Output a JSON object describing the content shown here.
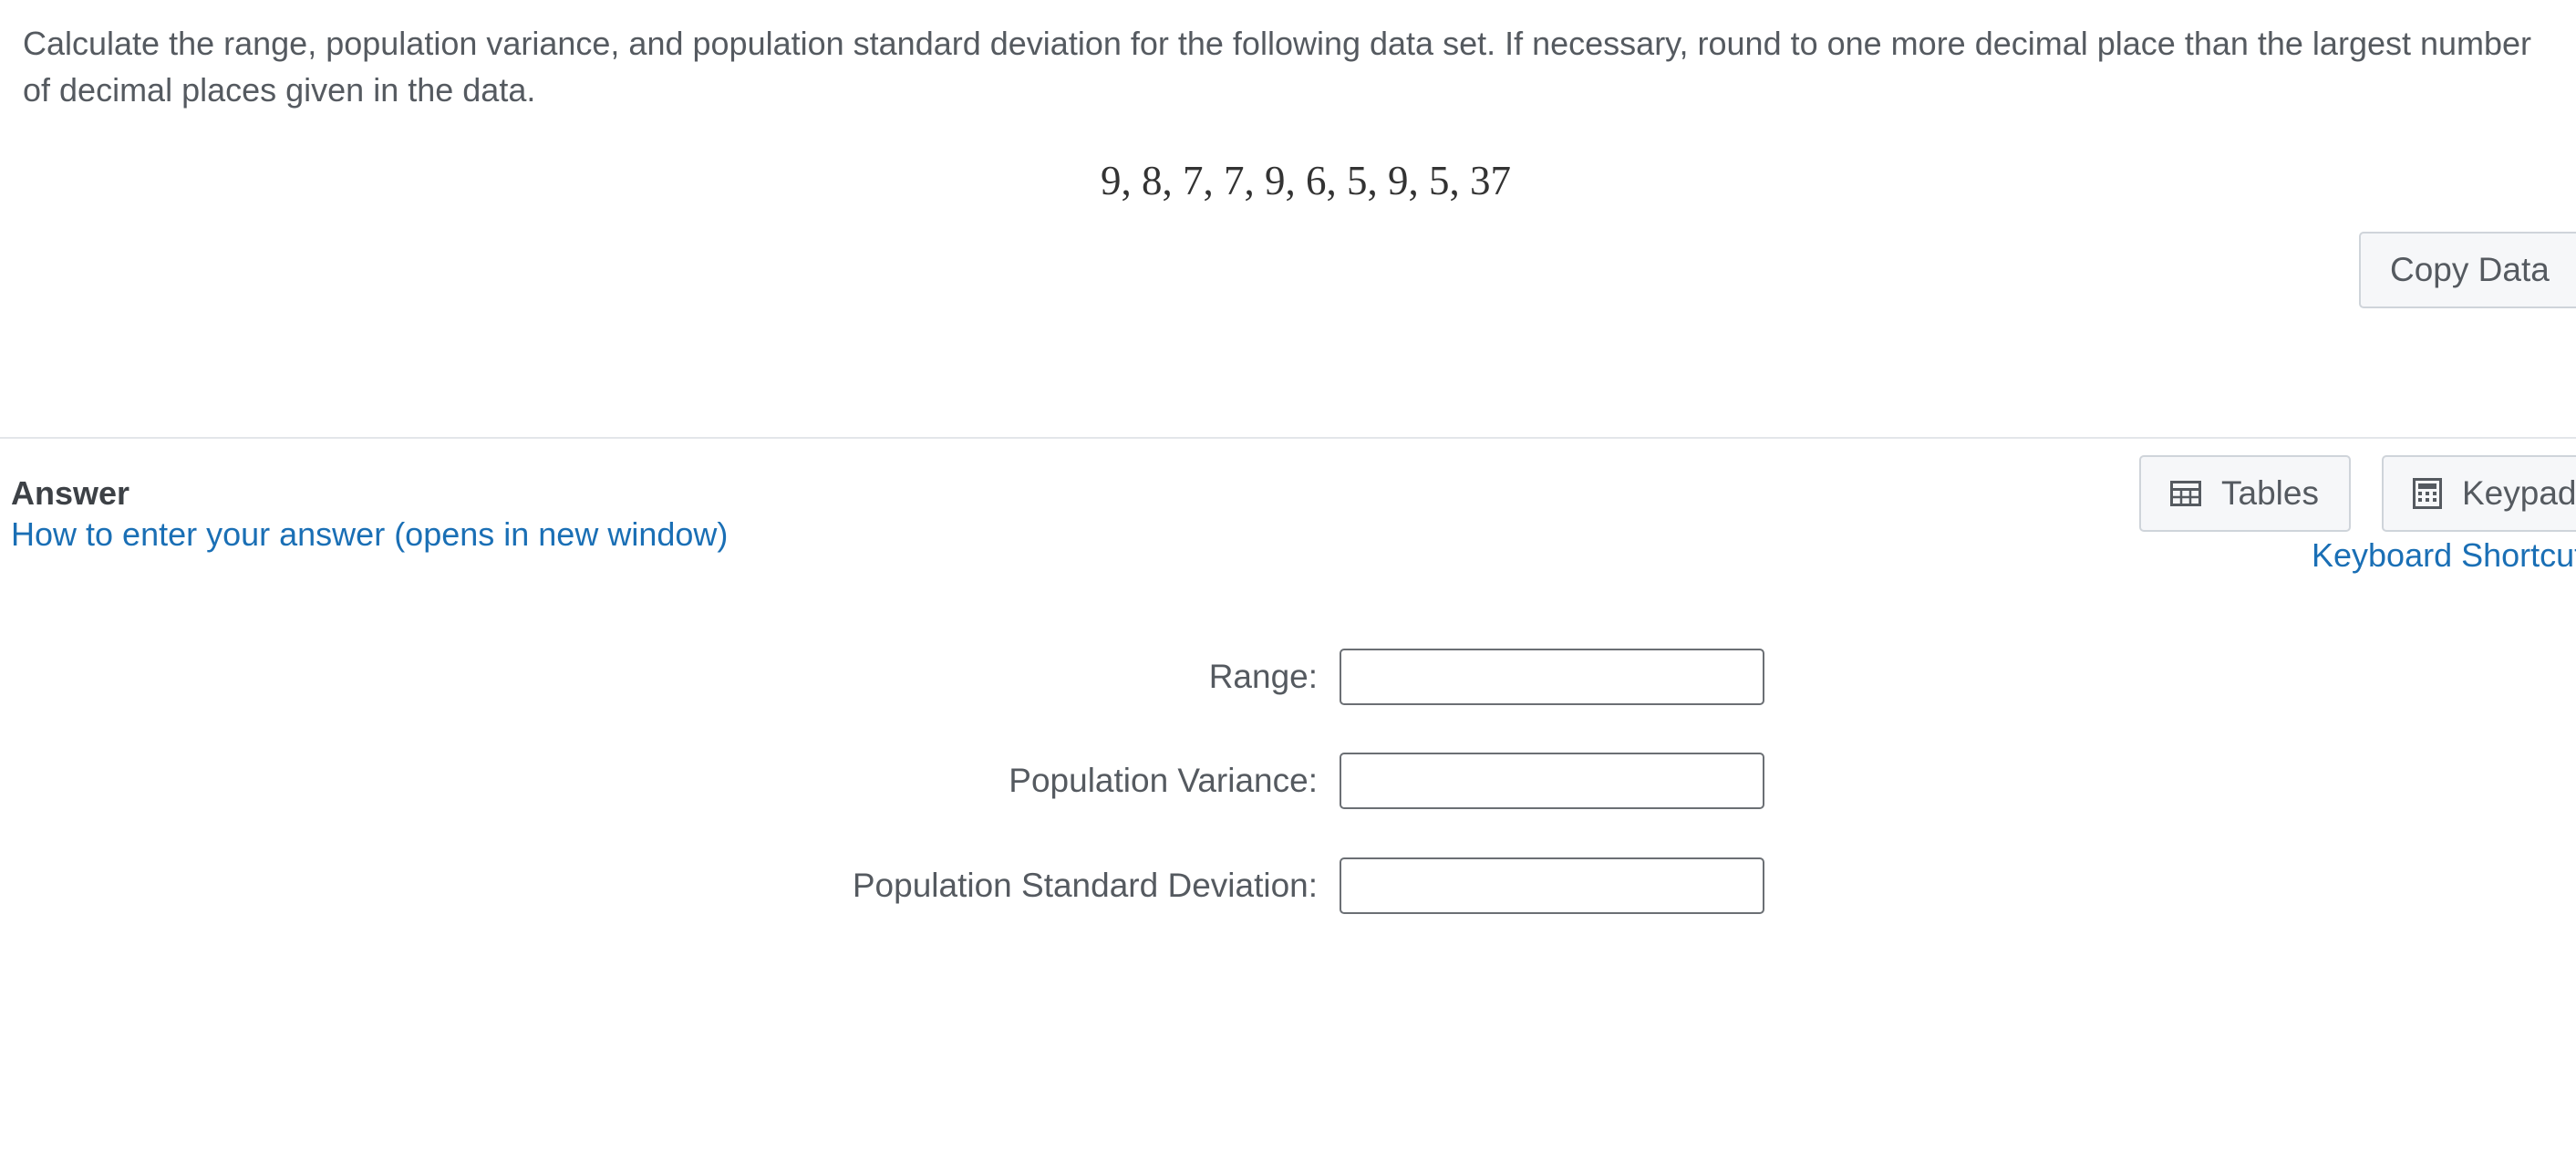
{
  "question": {
    "text": "Calculate the range, population variance, and population standard deviation for the following data set. If necessary, round to one more decimal place than the largest number of decimal places given in the data.",
    "dataset": "9, 8, 7, 7, 9, 6, 5, 9, 5, 37",
    "copy_button_label": "Copy Data"
  },
  "answer": {
    "title": "Answer",
    "help_link": "How to enter your answer (opens in new window)",
    "tables_label": "Tables",
    "keypad_label": "Keypad",
    "shortcuts_link": "Keyboard Shortcuts",
    "fields": [
      {
        "label": "Range:",
        "value": ""
      },
      {
        "label": "Population Variance:",
        "value": ""
      },
      {
        "label": "Population Standard Deviation:",
        "value": ""
      }
    ]
  },
  "icons": {
    "table": "table-icon",
    "calculator": "calculator-icon"
  },
  "colors": {
    "link": "#1a6fb5",
    "text": "#555a60"
  }
}
